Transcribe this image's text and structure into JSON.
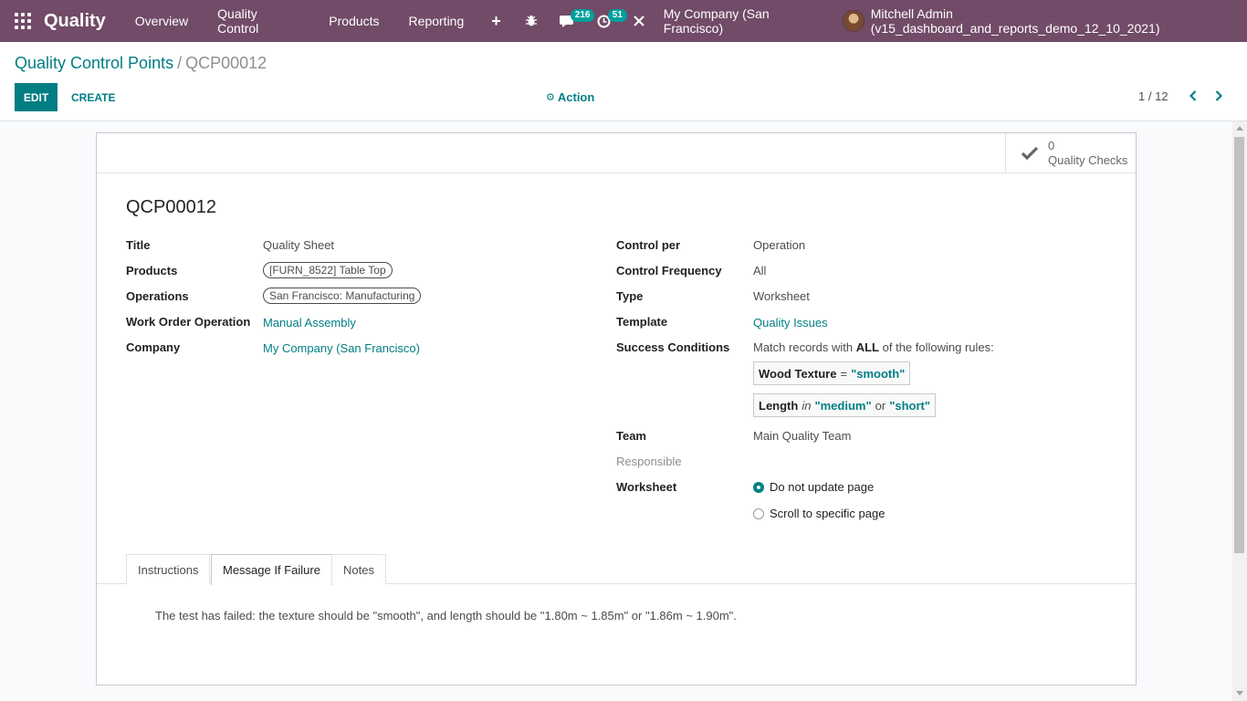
{
  "navbar": {
    "app_name": "Quality",
    "menu": [
      "Overview",
      "Quality Control",
      "Products",
      "Reporting"
    ],
    "plus": "+",
    "messages_count": "216",
    "activities_count": "51",
    "company": "My Company (San Francisco)",
    "user": "Mitchell Admin (v15_dashboard_and_reports_demo_12_10_2021)"
  },
  "breadcrumb": {
    "parent": "Quality Control Points",
    "separator": "/",
    "current": "QCP00012"
  },
  "toolbar": {
    "edit_label": "EDIT",
    "create_label": "CREATE",
    "action_label": "Action"
  },
  "pager": {
    "text": "1 / 12"
  },
  "stat_button": {
    "count": "0",
    "label": "Quality Checks"
  },
  "record": {
    "name": "QCP00012",
    "left_fields": {
      "title_label": "Title",
      "title_value": "Quality Sheet",
      "products_label": "Products",
      "products_tag": "[FURN_8522] Table Top",
      "operations_label": "Operations",
      "operations_tag": "San Francisco: Manufacturing",
      "wo_label": "Work Order Operation",
      "wo_value": "Manual Assembly",
      "company_label": "Company",
      "company_value": "My Company (San Francisco)"
    },
    "right_fields": {
      "control_per_label": "Control per",
      "control_per_value": "Operation",
      "frequency_label": "Control Frequency",
      "frequency_value": "All",
      "type_label": "Type",
      "type_value": "Worksheet",
      "template_label": "Template",
      "template_value": "Quality Issues",
      "success_label": "Success Conditions",
      "success_intro_1": "Match records with",
      "success_intro_all": "ALL",
      "success_intro_2": "of the following rules:",
      "rule1_field": "Wood Texture",
      "rule1_op": "=",
      "rule1_value": "\"smooth\"",
      "rule2_field": "Length",
      "rule2_op": "in",
      "rule2_value1": "\"medium\"",
      "rule2_or": "or",
      "rule2_value2": "\"short\"",
      "team_label": "Team",
      "team_value": "Main Quality Team",
      "responsible_label": "Responsible",
      "worksheet_label": "Worksheet",
      "worksheet_option1": "Do not update page",
      "worksheet_option2": "Scroll to specific page"
    }
  },
  "tabs": [
    "Instructions",
    "Message If Failure",
    "Notes"
  ],
  "tab_content": "The test has failed: the texture should be \"smooth\", and length should be \"1.80m ~ 1.85m\" or \"1.86m ~ 1.90m\".",
  "colors": {
    "navbar": "#714b67",
    "primary": "#017e84",
    "badge": "#00a09d"
  }
}
